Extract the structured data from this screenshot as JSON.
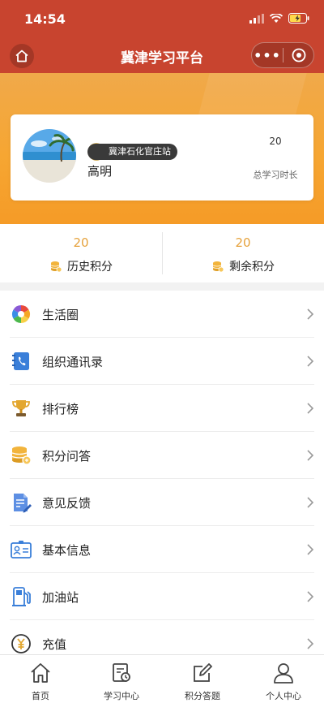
{
  "status": {
    "time": "14:54"
  },
  "nav": {
    "title": "冀津学习平台",
    "more": "•••"
  },
  "profile": {
    "station": "冀津石化官庄站",
    "name": "高明",
    "study_value": "20",
    "study_label": "总学习时长"
  },
  "points": {
    "history": {
      "value": "20",
      "label": "历史积分"
    },
    "remaining": {
      "value": "20",
      "label": "剩余积分"
    }
  },
  "menu": {
    "items": [
      {
        "label": "生活圈",
        "icon": "pinwheel-icon"
      },
      {
        "label": "组织通讯录",
        "icon": "phone-book-icon"
      },
      {
        "label": "排行榜",
        "icon": "trophy-icon"
      },
      {
        "label": "积分问答",
        "icon": "coins-icon"
      },
      {
        "label": "意见反馈",
        "icon": "feedback-icon"
      },
      {
        "label": "基本信息",
        "icon": "id-card-icon"
      },
      {
        "label": "加油站",
        "icon": "fuel-pump-icon"
      },
      {
        "label": "充值",
        "icon": "yuan-coin-icon"
      }
    ]
  },
  "tabs": [
    {
      "label": "首页",
      "icon": "home-icon"
    },
    {
      "label": "学习中心",
      "icon": "study-icon"
    },
    {
      "label": "积分答题",
      "icon": "edit-icon"
    },
    {
      "label": "个人中心",
      "icon": "person-icon"
    }
  ],
  "colors": {
    "brand": "#c8442f",
    "accent": "#f6a632",
    "points": "#e6a23c"
  }
}
